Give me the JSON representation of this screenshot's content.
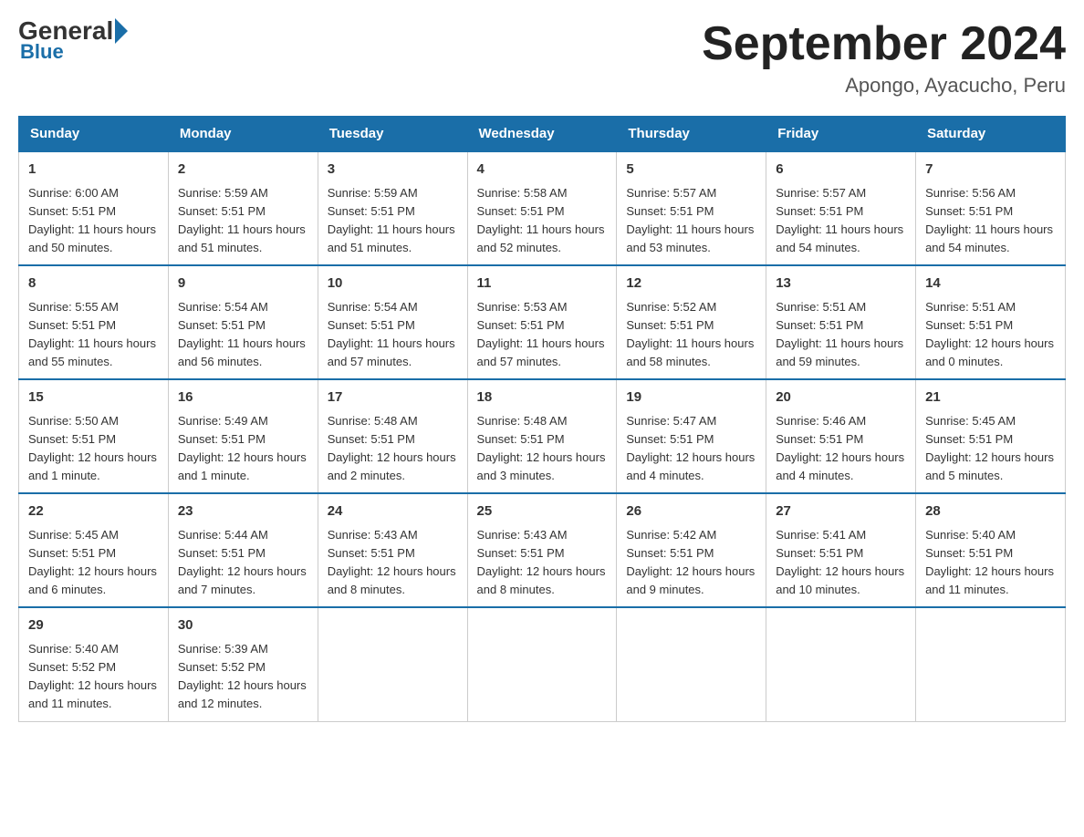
{
  "logo": {
    "general": "General",
    "blue": "Blue"
  },
  "title": "September 2024",
  "location": "Apongo, Ayacucho, Peru",
  "days_of_week": [
    "Sunday",
    "Monday",
    "Tuesday",
    "Wednesday",
    "Thursday",
    "Friday",
    "Saturday"
  ],
  "weeks": [
    [
      {
        "day": "1",
        "sunrise": "6:00 AM",
        "sunset": "5:51 PM",
        "daylight": "11 hours and 50 minutes."
      },
      {
        "day": "2",
        "sunrise": "5:59 AM",
        "sunset": "5:51 PM",
        "daylight": "11 hours and 51 minutes."
      },
      {
        "day": "3",
        "sunrise": "5:59 AM",
        "sunset": "5:51 PM",
        "daylight": "11 hours and 51 minutes."
      },
      {
        "day": "4",
        "sunrise": "5:58 AM",
        "sunset": "5:51 PM",
        "daylight": "11 hours and 52 minutes."
      },
      {
        "day": "5",
        "sunrise": "5:57 AM",
        "sunset": "5:51 PM",
        "daylight": "11 hours and 53 minutes."
      },
      {
        "day": "6",
        "sunrise": "5:57 AM",
        "sunset": "5:51 PM",
        "daylight": "11 hours and 54 minutes."
      },
      {
        "day": "7",
        "sunrise": "5:56 AM",
        "sunset": "5:51 PM",
        "daylight": "11 hours and 54 minutes."
      }
    ],
    [
      {
        "day": "8",
        "sunrise": "5:55 AM",
        "sunset": "5:51 PM",
        "daylight": "11 hours and 55 minutes."
      },
      {
        "day": "9",
        "sunrise": "5:54 AM",
        "sunset": "5:51 PM",
        "daylight": "11 hours and 56 minutes."
      },
      {
        "day": "10",
        "sunrise": "5:54 AM",
        "sunset": "5:51 PM",
        "daylight": "11 hours and 57 minutes."
      },
      {
        "day": "11",
        "sunrise": "5:53 AM",
        "sunset": "5:51 PM",
        "daylight": "11 hours and 57 minutes."
      },
      {
        "day": "12",
        "sunrise": "5:52 AM",
        "sunset": "5:51 PM",
        "daylight": "11 hours and 58 minutes."
      },
      {
        "day": "13",
        "sunrise": "5:51 AM",
        "sunset": "5:51 PM",
        "daylight": "11 hours and 59 minutes."
      },
      {
        "day": "14",
        "sunrise": "5:51 AM",
        "sunset": "5:51 PM",
        "daylight": "12 hours and 0 minutes."
      }
    ],
    [
      {
        "day": "15",
        "sunrise": "5:50 AM",
        "sunset": "5:51 PM",
        "daylight": "12 hours and 1 minute."
      },
      {
        "day": "16",
        "sunrise": "5:49 AM",
        "sunset": "5:51 PM",
        "daylight": "12 hours and 1 minute."
      },
      {
        "day": "17",
        "sunrise": "5:48 AM",
        "sunset": "5:51 PM",
        "daylight": "12 hours and 2 minutes."
      },
      {
        "day": "18",
        "sunrise": "5:48 AM",
        "sunset": "5:51 PM",
        "daylight": "12 hours and 3 minutes."
      },
      {
        "day": "19",
        "sunrise": "5:47 AM",
        "sunset": "5:51 PM",
        "daylight": "12 hours and 4 minutes."
      },
      {
        "day": "20",
        "sunrise": "5:46 AM",
        "sunset": "5:51 PM",
        "daylight": "12 hours and 4 minutes."
      },
      {
        "day": "21",
        "sunrise": "5:45 AM",
        "sunset": "5:51 PM",
        "daylight": "12 hours and 5 minutes."
      }
    ],
    [
      {
        "day": "22",
        "sunrise": "5:45 AM",
        "sunset": "5:51 PM",
        "daylight": "12 hours and 6 minutes."
      },
      {
        "day": "23",
        "sunrise": "5:44 AM",
        "sunset": "5:51 PM",
        "daylight": "12 hours and 7 minutes."
      },
      {
        "day": "24",
        "sunrise": "5:43 AM",
        "sunset": "5:51 PM",
        "daylight": "12 hours and 8 minutes."
      },
      {
        "day": "25",
        "sunrise": "5:43 AM",
        "sunset": "5:51 PM",
        "daylight": "12 hours and 8 minutes."
      },
      {
        "day": "26",
        "sunrise": "5:42 AM",
        "sunset": "5:51 PM",
        "daylight": "12 hours and 9 minutes."
      },
      {
        "day": "27",
        "sunrise": "5:41 AM",
        "sunset": "5:51 PM",
        "daylight": "12 hours and 10 minutes."
      },
      {
        "day": "28",
        "sunrise": "5:40 AM",
        "sunset": "5:51 PM",
        "daylight": "12 hours and 11 minutes."
      }
    ],
    [
      {
        "day": "29",
        "sunrise": "5:40 AM",
        "sunset": "5:52 PM",
        "daylight": "12 hours and 11 minutes."
      },
      {
        "day": "30",
        "sunrise": "5:39 AM",
        "sunset": "5:52 PM",
        "daylight": "12 hours and 12 minutes."
      },
      null,
      null,
      null,
      null,
      null
    ]
  ],
  "labels": {
    "sunrise": "Sunrise:",
    "sunset": "Sunset:",
    "daylight": "Daylight:"
  }
}
